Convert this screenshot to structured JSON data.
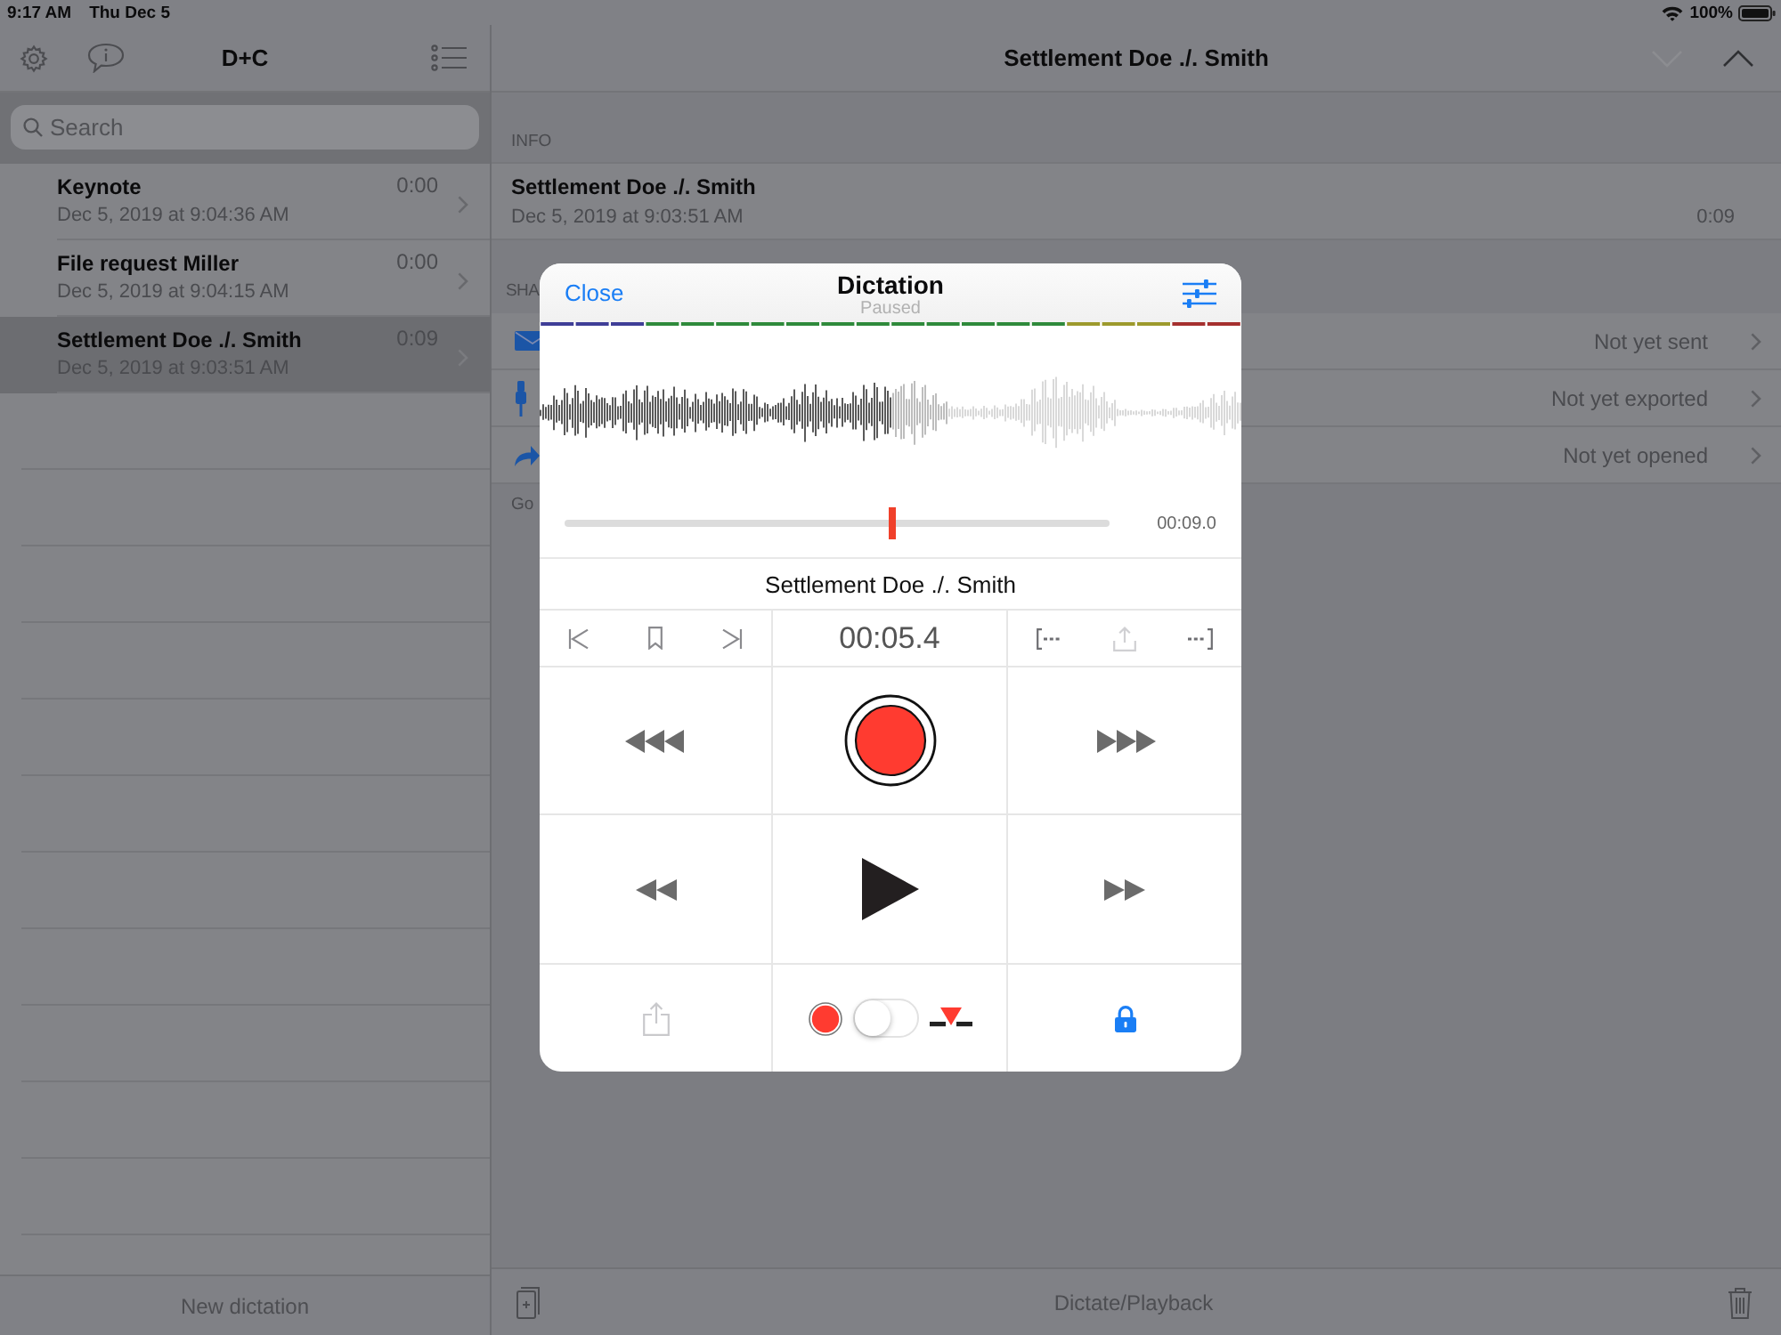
{
  "status_bar": {
    "time": "9:17 AM",
    "date": "Thu Dec 5",
    "battery": "100%"
  },
  "sidebar": {
    "title": "D+C",
    "search": {
      "placeholder": "Search"
    },
    "items": [
      {
        "title": "Keynote",
        "date": "Dec 5, 2019 at 9:04:36 AM",
        "duration": "0:00",
        "selected": false
      },
      {
        "title": "File request Miller",
        "date": "Dec 5, 2019 at 9:04:15 AM",
        "duration": "0:00",
        "selected": false
      },
      {
        "title": "Settlement Doe ./. Smith",
        "date": "Dec 5, 2019 at 9:03:51 AM",
        "duration": "0:09",
        "selected": true
      }
    ],
    "new_button": "New dictation"
  },
  "detail": {
    "title": "Settlement Doe ./. Smith",
    "nav_buttons": [
      {
        "kind": "down",
        "disabled": true
      },
      {
        "kind": "up",
        "disabled": false
      }
    ],
    "info_header": "INFO",
    "info": {
      "title": "Settlement Doe ./. Smith",
      "date": "Dec 5, 2019 at 9:03:51 AM",
      "duration": "0:09"
    },
    "share_header": "SHA",
    "share_rows": [
      {
        "kind": "mail",
        "status": "Not yet sent"
      },
      {
        "kind": "export",
        "status": "Not yet exported"
      },
      {
        "kind": "open",
        "status": "Not yet opened"
      }
    ],
    "footer_note": "Go",
    "toolbar_title": "Dictate/Playback"
  },
  "dialog": {
    "close_button": "Close",
    "title": "Dictation",
    "subtitle": "Paused",
    "position": {
      "level": 0.6,
      "reading": "00:09.0"
    },
    "name": "Settlement Doe ./. Smith",
    "current_time": "00:05.4",
    "clip_share": {
      "disabled": true
    },
    "share": {
      "disabled": true
    },
    "mode_switch": {
      "on": false
    }
  }
}
